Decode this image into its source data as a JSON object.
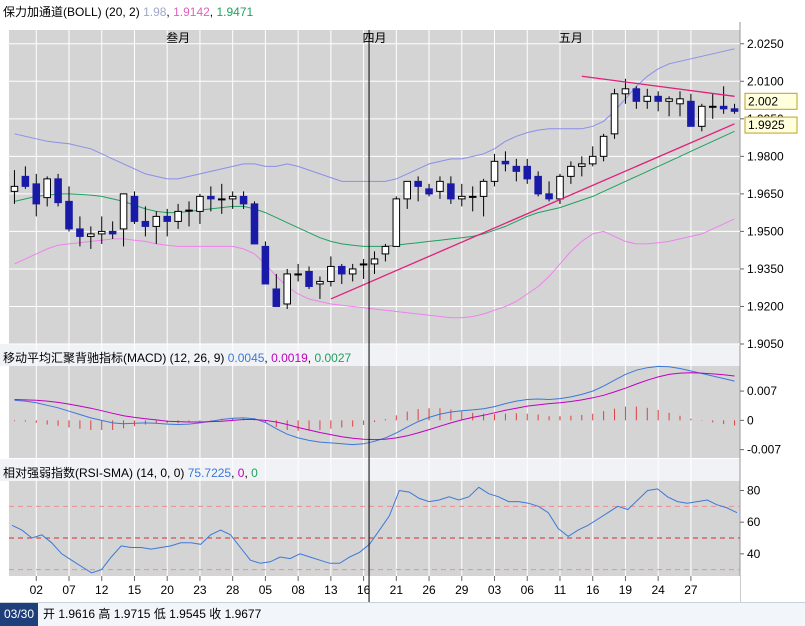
{
  "indicators": {
    "boll": {
      "name": "保力加通道(BOLL)",
      "params": "(20, 2)",
      "mid": "1.98",
      "lower": "1.9142",
      "upper": "1.9471",
      "colors": {
        "mid": "#9fa8c8",
        "lower": "#e060c0",
        "upper": "#20a060"
      }
    },
    "macd": {
      "name": "移动平均汇聚背驰指标(MACD)",
      "params": "(12, 26, 9)",
      "v1": "0.0045",
      "v2": "0.0019",
      "v3": "0.0027",
      "colors": {
        "v1": "#3c78d8",
        "v2": "#c000c0",
        "v3": "#20a060"
      }
    },
    "rsi": {
      "name": "相对强弱指数(RSI-SMA)",
      "params": "(14, 0, 0)",
      "v1": "75.7225",
      "v2": "0",
      "v3": "0",
      "colors": {
        "v1": "#3c78d8",
        "v2": "#c000c0",
        "v3": "#20a060"
      }
    }
  },
  "status": {
    "date": "03/30",
    "open_label": "开",
    "open": "1.9616",
    "high_label": "高",
    "high": "1.9715",
    "low_label": "低",
    "low": "1.9545",
    "close_label": "收",
    "close": "1.9677"
  },
  "chart_data": {
    "type": "candlestick",
    "month_labels": [
      {
        "label": "叁月",
        "index": 15
      },
      {
        "label": "四月",
        "index": 33
      },
      {
        "label": "五月",
        "index": 51
      }
    ],
    "x_labels": [
      {
        "label": "02",
        "index": 2
      },
      {
        "label": "07",
        "index": 5
      },
      {
        "label": "12",
        "index": 8
      },
      {
        "label": "15",
        "index": 11
      },
      {
        "label": "20",
        "index": 14
      },
      {
        "label": "23",
        "index": 17
      },
      {
        "label": "28",
        "index": 20
      },
      {
        "label": "05",
        "index": 23
      },
      {
        "label": "08",
        "index": 26
      },
      {
        "label": "13",
        "index": 29
      },
      {
        "label": "16",
        "index": 32
      },
      {
        "label": "21",
        "index": 35
      },
      {
        "label": "26",
        "index": 38
      },
      {
        "label": "29",
        "index": 41
      },
      {
        "label": "03",
        "index": 44
      },
      {
        "label": "06",
        "index": 47
      },
      {
        "label": "11",
        "index": 50
      },
      {
        "label": "16",
        "index": 53
      },
      {
        "label": "19",
        "index": 56
      },
      {
        "label": "24",
        "index": 59
      },
      {
        "label": "27",
        "index": 62
      }
    ],
    "price_axis": {
      "min": 1.905,
      "max": 2.0305,
      "ticks": [
        "2.0250",
        "2.0100",
        "1.9950",
        "1.9800",
        "1.9650",
        "1.9500",
        "1.9350",
        "1.9200",
        "1.9050"
      ]
    },
    "price_tags": [
      {
        "label": "2.002",
        "value": 2.002
      },
      {
        "label": "1.9925",
        "value": 1.9925
      }
    ],
    "candles": [
      [
        1.966,
        1.9745,
        1.961,
        1.968
      ],
      [
        1.972,
        1.976,
        1.967,
        1.968
      ],
      [
        1.969,
        1.973,
        1.956,
        1.961
      ],
      [
        1.9635,
        1.972,
        1.96,
        1.971
      ],
      [
        1.971,
        1.973,
        1.96,
        1.9615
      ],
      [
        1.962,
        1.968,
        1.95,
        1.951
      ],
      [
        1.951,
        1.956,
        1.944,
        1.948
      ],
      [
        1.948,
        1.952,
        1.943,
        1.949
      ],
      [
        1.949,
        1.956,
        1.945,
        1.95
      ],
      [
        1.95,
        1.954,
        1.947,
        1.949
      ],
      [
        1.951,
        1.965,
        1.944,
        1.965
      ],
      [
        1.964,
        1.966,
        1.953,
        1.954
      ],
      [
        1.954,
        1.96,
        1.948,
        1.952
      ],
      [
        1.952,
        1.958,
        1.945,
        1.956
      ],
      [
        1.956,
        1.959,
        1.948,
        1.954
      ],
      [
        1.954,
        1.961,
        1.951,
        1.958
      ],
      [
        1.9585,
        1.962,
        1.952,
        1.9585
      ],
      [
        1.958,
        1.965,
        1.953,
        1.964
      ],
      [
        1.964,
        1.968,
        1.958,
        1.963
      ],
      [
        1.963,
        1.969,
        1.957,
        1.963
      ],
      [
        1.963,
        1.966,
        1.959,
        1.964
      ],
      [
        1.964,
        1.966,
        1.959,
        1.961
      ],
      [
        1.961,
        1.962,
        1.945,
        1.945
      ],
      [
        1.944,
        1.946,
        1.929,
        1.929
      ],
      [
        1.927,
        1.933,
        1.92,
        1.92
      ],
      [
        1.921,
        1.935,
        1.919,
        1.933
      ],
      [
        1.933,
        1.937,
        1.93,
        1.933
      ],
      [
        1.934,
        1.936,
        1.927,
        1.928
      ],
      [
        1.929,
        1.932,
        1.923,
        1.93
      ],
      [
        1.93,
        1.94,
        1.928,
        1.936
      ],
      [
        1.936,
        1.937,
        1.929,
        1.933
      ],
      [
        1.933,
        1.937,
        1.93,
        1.935
      ],
      [
        1.937,
        1.939,
        1.931,
        1.937
      ],
      [
        1.937,
        1.942,
        1.933,
        1.939
      ],
      [
        1.941,
        1.945,
        1.938,
        1.944
      ],
      [
        1.944,
        1.964,
        1.944,
        1.963
      ],
      [
        1.963,
        1.97,
        1.959,
        1.97
      ],
      [
        1.97,
        1.972,
        1.962,
        1.968
      ],
      [
        1.967,
        1.969,
        1.964,
        1.965
      ],
      [
        1.966,
        1.972,
        1.963,
        1.97
      ],
      [
        1.969,
        1.972,
        1.961,
        1.963
      ],
      [
        1.963,
        1.969,
        1.96,
        1.964
      ],
      [
        1.964,
        1.968,
        1.958,
        1.964
      ],
      [
        1.964,
        1.971,
        1.956,
        1.97
      ],
      [
        1.97,
        1.981,
        1.968,
        1.978
      ],
      [
        1.978,
        1.982,
        1.974,
        1.977
      ],
      [
        1.976,
        1.979,
        1.97,
        1.974
      ],
      [
        1.976,
        1.979,
        1.969,
        1.971
      ],
      [
        1.972,
        1.974,
        1.964,
        1.965
      ],
      [
        1.965,
        1.97,
        1.962,
        1.963
      ],
      [
        1.963,
        1.973,
        1.961,
        1.972
      ],
      [
        1.972,
        1.978,
        1.969,
        1.976
      ],
      [
        1.976,
        1.98,
        1.972,
        1.977
      ],
      [
        1.977,
        1.984,
        1.976,
        1.98
      ],
      [
        1.98,
        1.989,
        1.978,
        1.988
      ],
      [
        1.989,
        2.007,
        1.987,
        2.005
      ],
      [
        2.005,
        2.011,
        2.001,
        2.007
      ],
      [
        2.007,
        2.008,
        1.999,
        2.002
      ],
      [
        2.002,
        2.007,
        1.999,
        2.004
      ],
      [
        2.004,
        2.006,
        1.998,
        2.002
      ],
      [
        2.002,
        2.004,
        1.996,
        2.003
      ],
      [
        2.001,
        2.006,
        1.996,
        2.003
      ],
      [
        2.002,
        2.005,
        1.992,
        1.992
      ],
      [
        1.992,
        2.001,
        1.99,
        2.0
      ],
      [
        2.0,
        2.005,
        1.995,
        2.0
      ],
      [
        2.0,
        2.008,
        1.997,
        1.999
      ],
      [
        1.999,
        2.001,
        1.997,
        1.998
      ]
    ],
    "boll_upper": [
      1.989,
      1.988,
      1.987,
      1.986,
      1.9855,
      1.985,
      1.984,
      1.983,
      1.981,
      1.979,
      1.977,
      1.975,
      1.973,
      1.972,
      1.971,
      1.971,
      1.972,
      1.973,
      1.974,
      1.975,
      1.976,
      1.977,
      1.977,
      1.976,
      1.976,
      1.977,
      1.976,
      1.9745,
      1.973,
      1.9715,
      1.97,
      1.97,
      1.97,
      1.97,
      1.97,
      1.971,
      1.973,
      1.975,
      1.977,
      1.978,
      1.979,
      1.979,
      1.98,
      1.981,
      1.983,
      1.986,
      1.988,
      1.9895,
      1.9905,
      1.991,
      1.991,
      1.991,
      1.991,
      1.992,
      1.994,
      1.998,
      2.003,
      2.008,
      2.012,
      2.015,
      2.017,
      2.018,
      2.019,
      2.02,
      2.021,
      2.022,
      2.023
    ],
    "boll_mid": [
      1.962,
      1.963,
      1.964,
      1.9645,
      1.965,
      1.965,
      1.9648,
      1.9645,
      1.964,
      1.963,
      1.962,
      1.9605,
      1.959,
      1.958,
      1.9575,
      1.9575,
      1.958,
      1.9585,
      1.959,
      1.9595,
      1.96,
      1.96,
      1.959,
      1.9575,
      1.9555,
      1.9535,
      1.9515,
      1.9495,
      1.9475,
      1.946,
      1.945,
      1.9445,
      1.944,
      1.944,
      1.944,
      1.9445,
      1.945,
      1.9455,
      1.946,
      1.9465,
      1.947,
      1.9475,
      1.948,
      1.949,
      1.9505,
      1.952,
      1.954,
      1.956,
      1.9575,
      1.9585,
      1.9595,
      1.961,
      1.9625,
      1.964,
      1.966,
      1.968,
      1.97,
      1.972,
      1.974,
      1.976,
      1.978,
      1.98,
      1.982,
      1.984,
      1.986,
      1.988,
      1.99
    ],
    "boll_lower": [
      1.937,
      1.939,
      1.941,
      1.943,
      1.9445,
      1.945,
      1.9455,
      1.946,
      1.9465,
      1.947,
      1.947,
      1.9465,
      1.946,
      1.945,
      1.9445,
      1.944,
      1.944,
      1.944,
      1.944,
      1.944,
      1.944,
      1.943,
      1.941,
      1.937,
      1.932,
      1.928,
      1.925,
      1.923,
      1.922,
      1.921,
      1.9205,
      1.92,
      1.9195,
      1.919,
      1.9185,
      1.918,
      1.9175,
      1.917,
      1.9165,
      1.916,
      1.9155,
      1.9155,
      1.916,
      1.917,
      1.9185,
      1.92,
      1.922,
      1.925,
      1.928,
      1.932,
      1.937,
      1.942,
      1.946,
      1.949,
      1.95,
      1.948,
      1.946,
      1.945,
      1.945,
      1.9455,
      1.946,
      1.947,
      1.948,
      1.949,
      1.951,
      1.953,
      1.955
    ],
    "trendlines": [
      {
        "from": [
          29,
          1.923
        ],
        "to": [
          66,
          1.993
        ],
        "color": "#e0207a"
      },
      {
        "from": [
          52,
          2.012
        ],
        "to": [
          66,
          2.004
        ],
        "color": "#e0207a"
      }
    ],
    "macd_axis": {
      "min": -0.009,
      "max": 0.013,
      "ticks": [
        "0.007",
        "0",
        "-0.007"
      ]
    },
    "macd_line1": [
      0.0048,
      0.0046,
      0.0042,
      0.0036,
      0.003,
      0.0022,
      0.0014,
      0.0006,
      0.0,
      -0.0006,
      -0.0008,
      -0.0007,
      -0.0006,
      -0.0007,
      -0.0009,
      -0.001,
      -0.0009,
      -0.0006,
      -0.0002,
      0.0002,
      0.0005,
      0.0006,
      0.0004,
      -0.0005,
      -0.002,
      -0.0033,
      -0.0042,
      -0.0048,
      -0.0052,
      -0.0054,
      -0.0056,
      -0.0058,
      -0.0056,
      -0.005,
      -0.0042,
      -0.003,
      -0.0016,
      -0.0003,
      0.0007,
      0.0015,
      0.002,
      0.0023,
      0.0025,
      0.0028,
      0.0033,
      0.004,
      0.0046,
      0.005,
      0.0051,
      0.005,
      0.0052,
      0.0056,
      0.0062,
      0.007,
      0.0082,
      0.0096,
      0.011,
      0.012,
      0.0126,
      0.0129,
      0.0128,
      0.0124,
      0.0118,
      0.0112,
      0.0106,
      0.01,
      0.0094
    ],
    "macd_line2": [
      0.005,
      0.0049,
      0.0048,
      0.0046,
      0.0043,
      0.0039,
      0.0034,
      0.0029,
      0.0023,
      0.0017,
      0.0011,
      0.0007,
      0.0004,
      0.0001,
      -0.0002,
      -0.0003,
      -0.0004,
      -0.0004,
      -0.0003,
      -0.0002,
      0.0,
      0.0002,
      0.0002,
      0.0,
      -0.0004,
      -0.001,
      -0.0017,
      -0.0023,
      -0.0029,
      -0.0034,
      -0.0039,
      -0.0043,
      -0.0045,
      -0.0046,
      -0.0045,
      -0.0042,
      -0.0037,
      -0.003,
      -0.0022,
      -0.0014,
      -0.0006,
      0.0001,
      0.0007,
      0.0012,
      0.0018,
      0.0024,
      0.0029,
      0.0034,
      0.0037,
      0.004,
      0.0042,
      0.0045,
      0.0049,
      0.0054,
      0.006,
      0.0068,
      0.0077,
      0.0087,
      0.0096,
      0.0104,
      0.011,
      0.0113,
      0.0114,
      0.0113,
      0.0111,
      0.0109,
      0.0106
    ],
    "macd_hist": [
      -0.0002,
      -0.0003,
      -0.0006,
      -0.001,
      -0.0013,
      -0.0017,
      -0.002,
      -0.0023,
      -0.0023,
      -0.0023,
      -0.0019,
      -0.0014,
      -0.001,
      -0.0008,
      -0.0007,
      -0.0007,
      -0.0005,
      -0.0002,
      0.0001,
      0.0004,
      0.0005,
      0.0004,
      0.0002,
      -0.0005,
      -0.0016,
      -0.0023,
      -0.0025,
      -0.0025,
      -0.0023,
      -0.002,
      -0.0017,
      -0.0015,
      -0.0011,
      -0.0004,
      0.0003,
      0.0012,
      0.0021,
      0.0027,
      0.0029,
      0.0029,
      0.0026,
      0.0022,
      0.0018,
      0.0016,
      0.0015,
      0.0016,
      0.0017,
      0.0016,
      0.0014,
      0.001,
      0.001,
      0.0011,
      0.0013,
      0.0016,
      0.0022,
      0.0028,
      0.0033,
      0.0033,
      0.003,
      0.0025,
      0.0018,
      0.0011,
      0.0004,
      -0.0001,
      -0.0005,
      -0.0009,
      -0.0012
    ],
    "rsi_axis": {
      "min": 26,
      "max": 86,
      "ticks": [
        "80",
        "60",
        "40"
      ]
    },
    "rsi_levels": [
      {
        "value": 50,
        "color": "#d03030"
      },
      {
        "value": 30,
        "color": "#e89090"
      },
      {
        "value": 70,
        "color": "#e89090"
      }
    ],
    "rsi": [
      58,
      55,
      50,
      52,
      47,
      40,
      36,
      32,
      28,
      30,
      38,
      45,
      44,
      44,
      43,
      44,
      45,
      47,
      47,
      46,
      52,
      55,
      52,
      44,
      36,
      34,
      35,
      38,
      37,
      40,
      38,
      36,
      34,
      34,
      38,
      41,
      46,
      55,
      64,
      80,
      79,
      75,
      73,
      74,
      76,
      74,
      76,
      82,
      78,
      76,
      73,
      73,
      72,
      70,
      66,
      56,
      51,
      55,
      58,
      62,
      66,
      70,
      68,
      74,
      80,
      81,
      76,
      73,
      72,
      73,
      74,
      71,
      69,
      66
    ]
  }
}
